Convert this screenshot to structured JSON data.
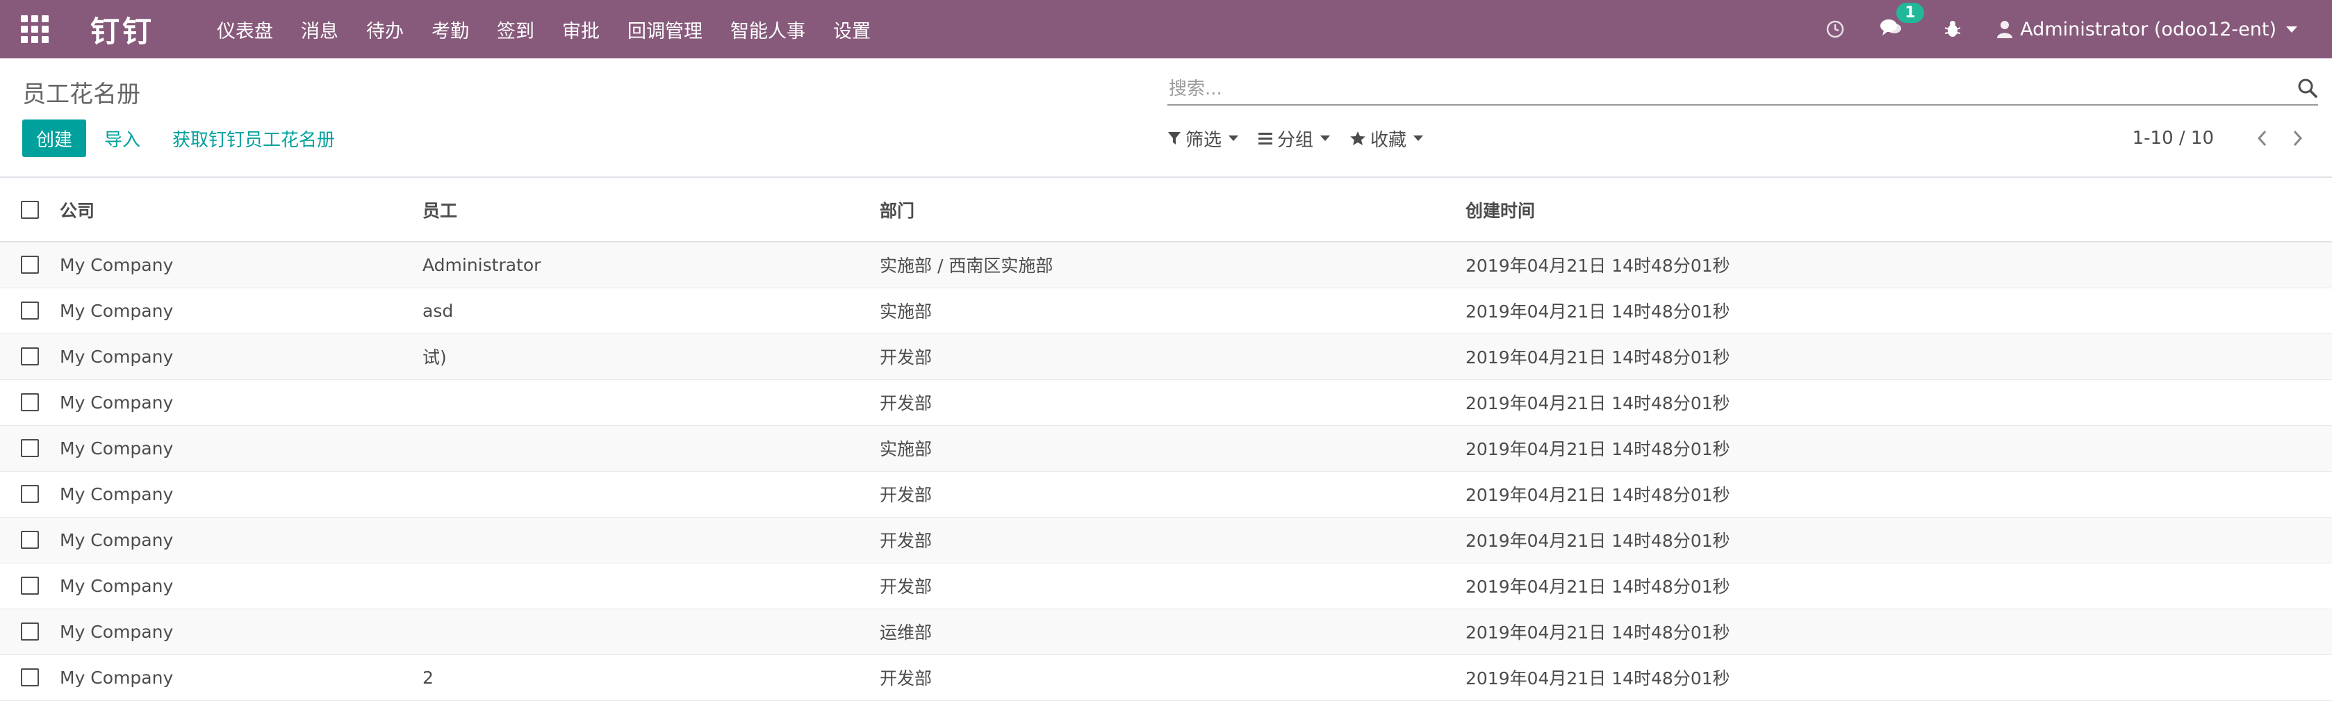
{
  "navbar": {
    "brand": "钉钉",
    "menu": [
      "仪表盘",
      "消息",
      "待办",
      "考勤",
      "签到",
      "审批",
      "回调管理",
      "智能人事",
      "设置"
    ],
    "message_count": "1",
    "user": "Administrator (odoo12-ent)",
    "colors": {
      "navbar_bg": "#875A7B",
      "badge_bg": "#21B799"
    }
  },
  "control": {
    "title": "员工花名册",
    "search_placeholder": "搜索...",
    "create_label": "创建",
    "import_label": "导入",
    "fetch_label": "获取钉钉员工花名册",
    "filter_label": "筛选",
    "group_label": "分组",
    "favorites_label": "收藏",
    "pager": "1-10 / 10",
    "colors": {
      "primary": "#00A09D"
    }
  },
  "table": {
    "headers": {
      "company": "公司",
      "employee": "员工",
      "department": "部门",
      "created": "创建时间"
    },
    "rows": [
      {
        "company": "My Company",
        "employee": "Administrator",
        "department": "实施部 / 西南区实施部",
        "created": "2019年04月21日 14时48分01秒"
      },
      {
        "company": "My Company",
        "employee": "asd",
        "department": "实施部",
        "created": "2019年04月21日 14时48分01秒"
      },
      {
        "company": "My Company",
        "employee": "试)",
        "department": "开发部",
        "created": "2019年04月21日 14时48分01秒"
      },
      {
        "company": "My Company",
        "employee": "",
        "department": "开发部",
        "created": "2019年04月21日 14时48分01秒"
      },
      {
        "company": "My Company",
        "employee": "",
        "department": "实施部",
        "created": "2019年04月21日 14时48分01秒"
      },
      {
        "company": "My Company",
        "employee": "",
        "department": "开发部",
        "created": "2019年04月21日 14时48分01秒"
      },
      {
        "company": "My Company",
        "employee": "",
        "department": "开发部",
        "created": "2019年04月21日 14时48分01秒"
      },
      {
        "company": "My Company",
        "employee": "",
        "department": "开发部",
        "created": "2019年04月21日 14时48分01秒"
      },
      {
        "company": "My Company",
        "employee": "",
        "department": "运维部",
        "created": "2019年04月21日 14时48分01秒"
      },
      {
        "company": "My Company",
        "employee": "2",
        "department": "开发部",
        "created": "2019年04月21日 14时48分01秒"
      }
    ]
  }
}
